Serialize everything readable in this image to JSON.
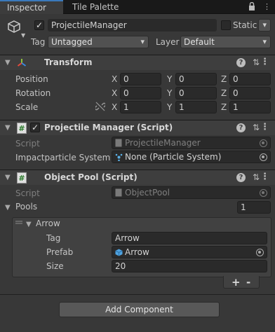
{
  "tabs": [
    {
      "label": "Inspector",
      "active": true
    },
    {
      "label": "Tile Palette",
      "active": false
    }
  ],
  "header": {
    "object_name": "ProjectileManager",
    "active": true,
    "static_label": "Static",
    "tag_label": "Tag",
    "tag_value": "Untagged",
    "layer_label": "Layer",
    "layer_value": "Default"
  },
  "transform": {
    "title": "Transform",
    "rows": [
      {
        "label": "Position",
        "x": "0",
        "y": "0",
        "z": "0"
      },
      {
        "label": "Rotation",
        "x": "0",
        "y": "0",
        "z": "0"
      },
      {
        "label": "Scale",
        "x": "1",
        "y": "1",
        "z": "1"
      }
    ],
    "axes": {
      "x": "X",
      "y": "Y",
      "z": "Z"
    }
  },
  "projectile_manager": {
    "title": "Projectile Manager (Script)",
    "enabled": true,
    "script_label": "Script",
    "script_value": "ProjectileManager",
    "impact_label": "Impactparticle System",
    "impact_value": "None (Particle System)"
  },
  "object_pool": {
    "title": "Object Pool (Script)",
    "script_label": "Script",
    "script_value": "ObjectPool",
    "pools_label": "Pools",
    "pools_count": "1",
    "element": {
      "name": "Arrow",
      "tag_label": "Tag",
      "tag_value": "Arrow",
      "prefab_label": "Prefab",
      "prefab_value": "Arrow",
      "size_label": "Size",
      "size_value": "20"
    },
    "add_label": "+",
    "remove_label": "-"
  },
  "add_component_label": "Add Component",
  "colors": {
    "background": "#383838",
    "accent": "#3a79bb",
    "field": "#2a2a2a"
  }
}
